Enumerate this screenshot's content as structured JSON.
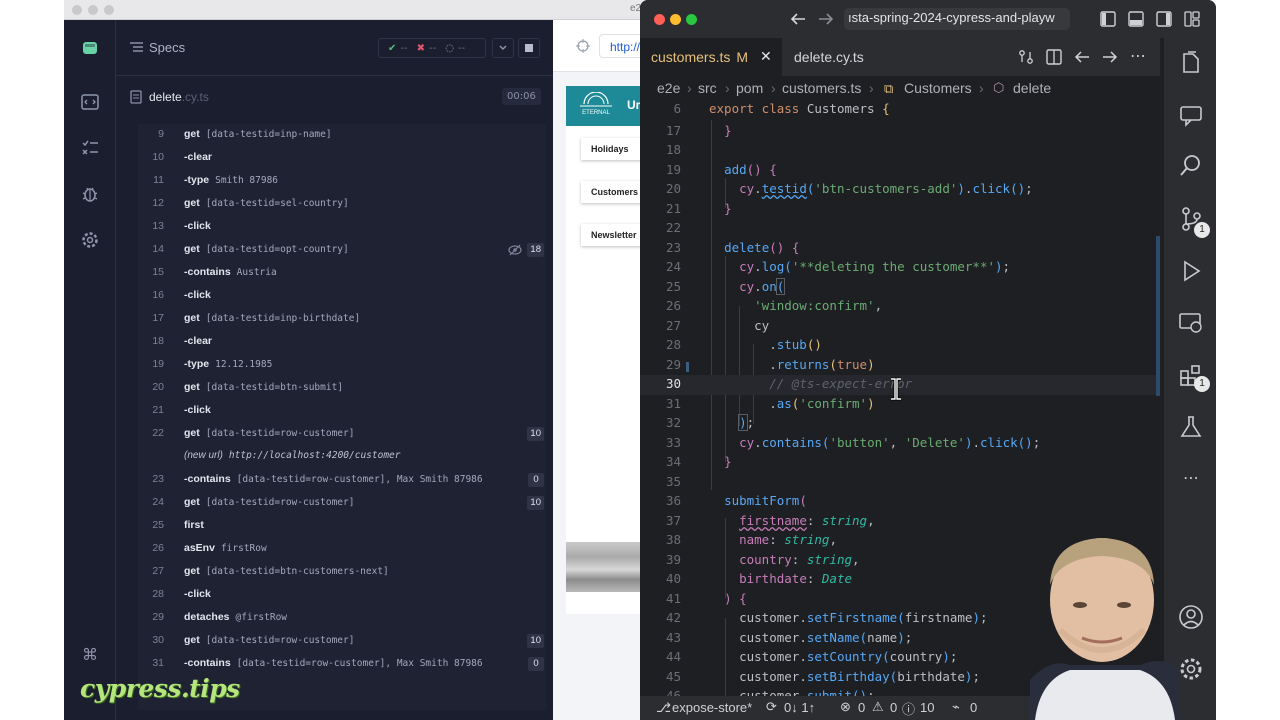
{
  "cypress": {
    "window_title_fragment": "e2",
    "specs_label": "Specs",
    "stats": {
      "passed": "--",
      "failed": "--",
      "pending": "--"
    },
    "spec_file": {
      "name": "delete",
      "ext": ".cy.ts",
      "duration": "00:06"
    },
    "commands": [
      {
        "num": "9",
        "name": "get",
        "msg": "[data-testid=inp-name]",
        "badge": ""
      },
      {
        "num": "10",
        "name": "-clear",
        "msg": "",
        "badge": ""
      },
      {
        "num": "11",
        "name": "-type",
        "msg": "Smith 87986",
        "badge": ""
      },
      {
        "num": "12",
        "name": "get",
        "msg": "[data-testid=sel-country]",
        "badge": ""
      },
      {
        "num": "13",
        "name": "-click",
        "msg": "",
        "badge": ""
      },
      {
        "num": "14",
        "name": "get",
        "msg": "[data-testid=opt-country]",
        "badge": "18"
      },
      {
        "num": "15",
        "name": "-contains",
        "msg": "Austria",
        "badge": ""
      },
      {
        "num": "16",
        "name": "-click",
        "msg": "",
        "badge": ""
      },
      {
        "num": "17",
        "name": "get",
        "msg": "[data-testid=inp-birthdate]",
        "badge": ""
      },
      {
        "num": "18",
        "name": "-clear",
        "msg": "",
        "badge": ""
      },
      {
        "num": "19",
        "name": "-type",
        "msg": "12.12.1985",
        "badge": ""
      },
      {
        "num": "20",
        "name": "get",
        "msg": "[data-testid=btn-submit]",
        "badge": ""
      },
      {
        "num": "21",
        "name": "-click",
        "msg": "",
        "badge": ""
      },
      {
        "num": "22",
        "name": "get",
        "msg": "[data-testid=row-customer]",
        "badge": "10"
      },
      {
        "num": "",
        "name": "(new url)",
        "msg": "http://localhost:4200/customer",
        "badge": ""
      },
      {
        "num": "23",
        "name": "-contains",
        "msg": "[data-testid=row-customer], Max Smith 87986",
        "badge": "0"
      },
      {
        "num": "24",
        "name": "get",
        "msg": "[data-testid=row-customer]",
        "badge": "10"
      },
      {
        "num": "25",
        "name": "first",
        "msg": "",
        "badge": ""
      },
      {
        "num": "26",
        "name": "asEnv",
        "msg": "firstRow",
        "badge": ""
      },
      {
        "num": "27",
        "name": "get",
        "msg": "[data-testid=btn-customers-next]",
        "badge": ""
      },
      {
        "num": "28",
        "name": "-click",
        "msg": "",
        "badge": ""
      },
      {
        "num": "29",
        "name": "detaches",
        "msg": "@firstRow",
        "badge": ""
      },
      {
        "num": "30",
        "name": "get",
        "msg": "[data-testid=row-customer]",
        "badge": "10"
      },
      {
        "num": "31",
        "name": "-contains",
        "msg": "[data-testid=row-customer], Max Smith 87986",
        "badge": "0"
      }
    ],
    "logo_text": "cypress.tips"
  },
  "app_preview": {
    "url": "http://",
    "brand_logo_text": "ETERNAL",
    "brand_text": "Ur",
    "menu": [
      "Holidays",
      "Customers",
      "Newsletter"
    ]
  },
  "vscode": {
    "search_text": "ısta-spring-2024-cypress-and-playw",
    "tabs": [
      {
        "label": "customers.ts",
        "modified": "M",
        "active": true
      },
      {
        "label": "delete.cy.ts",
        "active": false
      }
    ],
    "breadcrumb": [
      "e2e",
      "src",
      "pom",
      "customers.ts",
      "Customers",
      "delete"
    ],
    "current_line": "30",
    "status": {
      "branch": "expose-store*",
      "sync": "0↓ 1↑",
      "errors": "0",
      "warnings": "0",
      "info": "10",
      "ports": "0"
    },
    "badges": {
      "scm": "1",
      "extensions": "1"
    }
  },
  "colors": {
    "cypress_bg": "#1b1e2e",
    "vscode_bg": "#1e1f22",
    "keyword": "#cf8e6d",
    "string": "#6aab73",
    "function": "#56a8f5",
    "property": "#c77dbb",
    "brand_teal": "#1e8a98"
  }
}
